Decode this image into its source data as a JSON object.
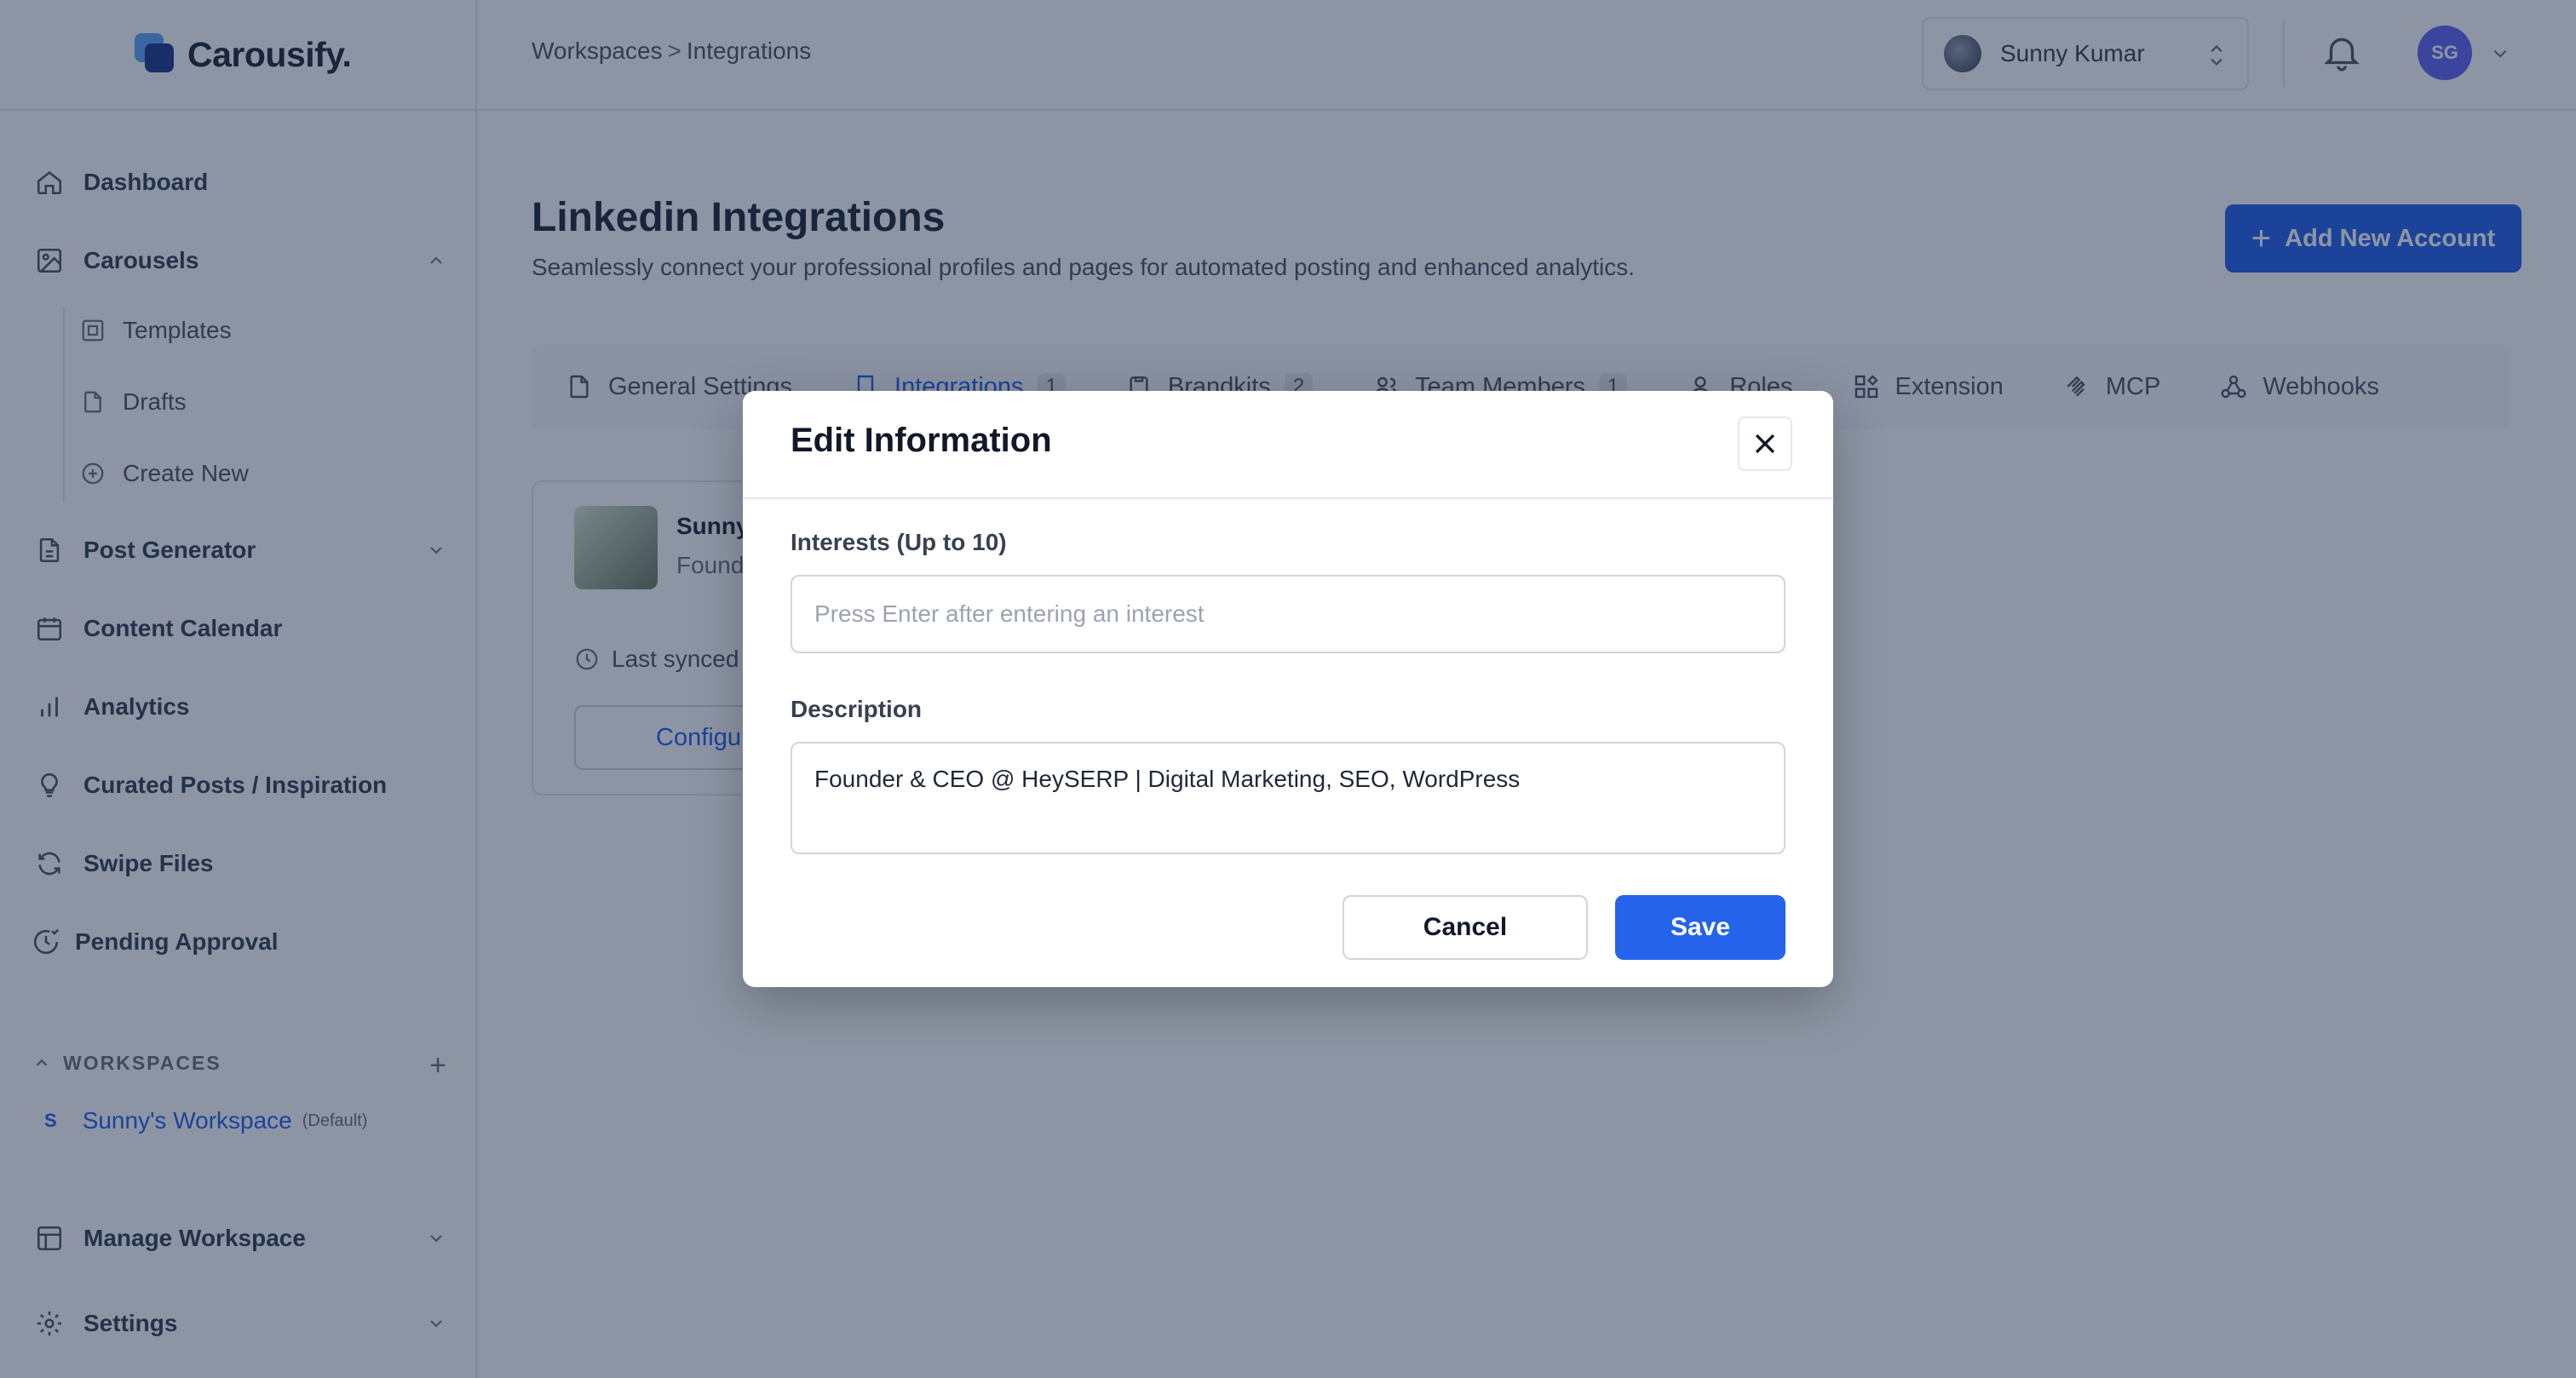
{
  "app": {
    "name": "Carousify."
  },
  "breadcrumb": {
    "parent": "Workspaces",
    "separator": ">",
    "current": "Integrations"
  },
  "user_switcher": {
    "name": "Sunny Kumar"
  },
  "account_menu": {
    "initials": "SG"
  },
  "sidebar": {
    "dashboard": "Dashboard",
    "carousels": "Carousels",
    "carousel_children": {
      "templates": "Templates",
      "drafts": "Drafts",
      "create_new": "Create New"
    },
    "post_generator": "Post Generator",
    "content_calendar": "Content Calendar",
    "analytics": "Analytics",
    "curated_posts": "Curated Posts / Inspiration",
    "swipe_files": "Swipe Files",
    "pending_approval": "Pending Approval",
    "workspaces_header": "WORKSPACES",
    "workspace": {
      "badge": "S",
      "name": "Sunny's Workspace",
      "tag": "(Default)"
    },
    "manage_workspace": "Manage Workspace",
    "settings": "Settings"
  },
  "page": {
    "title": "Linkedin Integrations",
    "subtitle": "Seamlessly connect your professional profiles and pages for automated posting and enhanced analytics.",
    "add_button": "Add New Account"
  },
  "tabs": {
    "general": "General Settings",
    "integrations": "Integrations",
    "integrations_count": "1",
    "brandkits": "Brandkits",
    "brandkits_count": "2",
    "team": "Team Members",
    "team_count": "1",
    "roles": "Roles",
    "extension": "Extension",
    "mcp": "MCP",
    "webhooks": "Webhooks"
  },
  "account_card": {
    "name": "Sunny",
    "role": "Found",
    "sync": "Last synced",
    "configure": "Configu"
  },
  "modal": {
    "title": "Edit Information",
    "interests_label": "Interests (Up to 10)",
    "interests_placeholder": "Press Enter after entering an interest",
    "description_label": "Description",
    "description_value": "Founder & CEO @ HeySERP | Digital Marketing, SEO, WordPress",
    "cancel": "Cancel",
    "save": "Save"
  },
  "colors": {
    "accent": "#2563eb",
    "overlay": "rgba(17,34,64,0.48)",
    "avatar": "#6366f1"
  }
}
